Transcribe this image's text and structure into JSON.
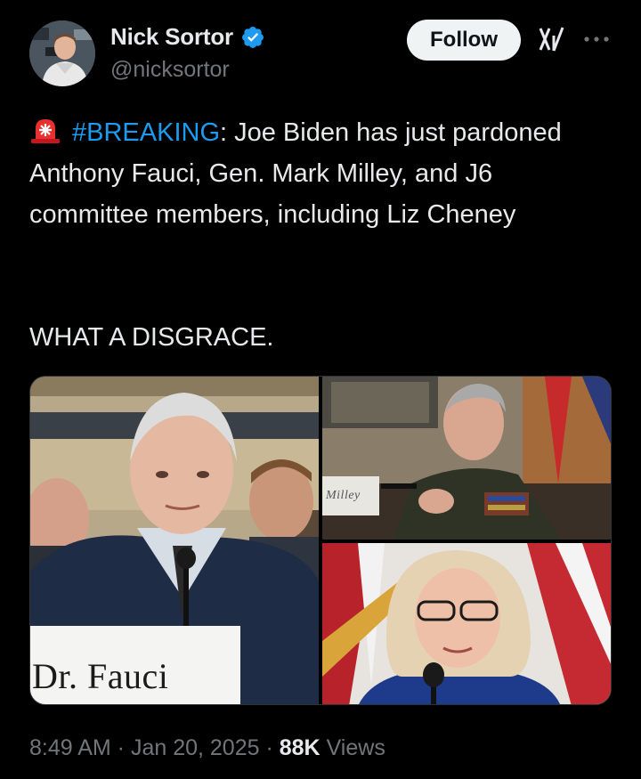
{
  "author": {
    "display_name": "Nick Sortor",
    "handle": "@nicksortor",
    "verified": true,
    "verified_color": "#1d9bf0"
  },
  "actions": {
    "follow_label": "Follow",
    "grok_icon": "grok-icon",
    "more_icon": "more-options-icon"
  },
  "tweet": {
    "emoji": "rotating-light-icon",
    "hashtag": "#BREAKING",
    "text_after_hashtag": ": Joe Biden has just pardoned Anthony Fauci, Gen. Mark Milley, and J6 committee members, including Liz Cheney",
    "second_paragraph": "WHAT A DISGRACE."
  },
  "media": {
    "nameplate_left": "Dr. Fauci",
    "nameplate_top_right": "Milley"
  },
  "footer": {
    "time": "8:49 AM",
    "separator": " · ",
    "date": "Jan 20, 2025",
    "views_count": "88K",
    "views_label": "Views"
  },
  "colors": {
    "background": "#000000",
    "text": "#e7e9ea",
    "secondary": "#71767b",
    "accent": "#1d9bf0"
  }
}
